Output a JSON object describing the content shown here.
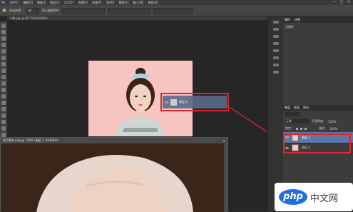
{
  "app": {
    "logo": "Ps",
    "menu": [
      "文件(F)",
      "编辑(E)",
      "图像(I)",
      "图层(L)",
      "文字(Y)",
      "选择(S)",
      "滤镜(T)",
      "3D(D)",
      "视图(V)",
      "窗口(W)",
      "帮助(H)"
    ],
    "window_buttons": [
      "—",
      "□",
      "✕"
    ]
  },
  "options_bar": {
    "auto_select_label": "自动选择：",
    "auto_select_value": "组",
    "transform_label": "显示变换控件"
  },
  "document_tab": {
    "label": "人物.jpg @ 66.7%(RGB/8#)"
  },
  "drag_preview": {
    "label": "图层 1"
  },
  "properties_panel": {
    "tabs": [
      "属性",
      "调整"
    ],
    "body_text": "无属性"
  },
  "layers_panel": {
    "tabs": [
      "图层",
      "通道",
      "路径"
    ],
    "blend_mode": "正常",
    "opacity_label": "不透明度：",
    "opacity_value": "100%",
    "lock_label": "锁定：",
    "fill_label": "填充：",
    "fill_value": "100%",
    "layers": [
      {
        "name": "图层 1",
        "selected": true
      },
      {
        "name": "图层 0",
        "selected": false
      }
    ]
  },
  "float_window": {
    "title": "首页素材.png @ 100% (图层 1, RGB/8#)",
    "close": "✕"
  },
  "watermark": {
    "logo": "php",
    "text": "中文网"
  },
  "colors": {
    "highlight": "#e0262b",
    "background": "#282828",
    "photo_bg": "#f7c4c1"
  }
}
